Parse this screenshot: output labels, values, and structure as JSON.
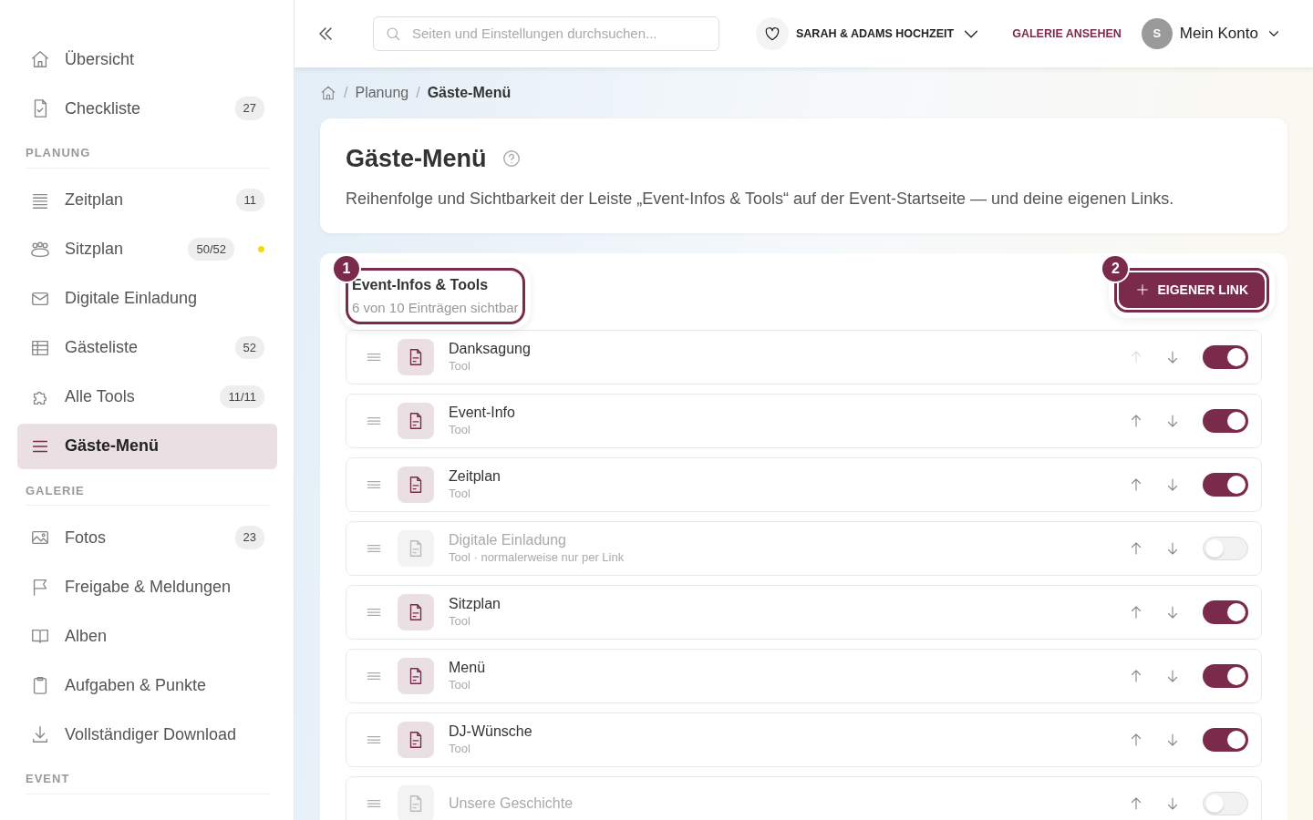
{
  "sidebar": {
    "groups": [
      {
        "items": [
          {
            "label": "Übersicht",
            "selected": false
          },
          {
            "label": "Checkliste",
            "count": "27",
            "selected": false
          }
        ]
      },
      {
        "heading": "PLANUNG",
        "items": [
          {
            "label": "Zeitplan",
            "count": "11",
            "selected": false
          },
          {
            "label": "Sitzplan",
            "count": "50/52",
            "color": "#f5d90a",
            "selected": false
          },
          {
            "label": "Digitale Einladung",
            "selected": false
          },
          {
            "label": "Gästeliste",
            "count": "52",
            "selected": false
          },
          {
            "label": "Alle Tools",
            "count": "11/11",
            "selected": false
          },
          {
            "label": "Gäste-Menü",
            "selected": true
          }
        ]
      },
      {
        "heading": "GALERIE",
        "items": [
          {
            "label": "Fotos",
            "count": "23",
            "selected": false
          },
          {
            "label": "Freigabe & Meldungen",
            "selected": false
          },
          {
            "label": "Alben",
            "selected": false
          },
          {
            "label": "Aufgaben & Punkte",
            "selected": false
          },
          {
            "label": "Vollständiger Download",
            "selected": false
          }
        ]
      },
      {
        "heading": "EVENT"
      }
    ]
  },
  "topbar": {
    "search": {
      "placeholder": "Seiten und Einstellungen durchsuchen..."
    },
    "event": "SARAH & ADAMS HOCHZEIT",
    "gallery_link": "GALERIE ANSEHEN",
    "avatar": "S",
    "account": "Mein Konto"
  },
  "breadcrumb": [
    {
      "separator": "/",
      "label": "Planung"
    },
    {
      "separator": "/",
      "label": "Gäste-Menü"
    }
  ],
  "header": {
    "title": "Gäste-Menü",
    "description": "Reihenfolge und Sichtbarkeit der Leiste „Event-Infos & Tools“ auf der Event-Startseite — und deine eigenen Links."
  },
  "section": {
    "title": "Event-Infos & Tools",
    "subtitle": "6 von 10 Einträgen sichtbar",
    "step": "1",
    "button": "EIGENER LINK",
    "button_step": "2",
    "items": [
      {
        "name": "Danksagung",
        "type": "Tool",
        "visible": true,
        "can_move_up": false
      },
      {
        "name": "Event-Info",
        "type": "Tool",
        "visible": true,
        "can_move_up": true
      },
      {
        "name": "Zeitplan",
        "type": "Tool",
        "visible": true,
        "can_move_up": true
      },
      {
        "name": "Digitale Einladung",
        "type": "Tool · normalerweise nur per Link",
        "visible": false,
        "can_move_up": true
      },
      {
        "name": "Sitzplan",
        "type": "Tool",
        "visible": true,
        "can_move_up": true
      },
      {
        "name": "Menü",
        "type": "Tool",
        "visible": true,
        "can_move_up": true
      },
      {
        "name": "DJ-Wünsche",
        "type": "Tool",
        "visible": true,
        "can_move_up": true
      },
      {
        "name": "Unsere Geschichte",
        "visible": false,
        "can_move_up": true
      }
    ]
  }
}
